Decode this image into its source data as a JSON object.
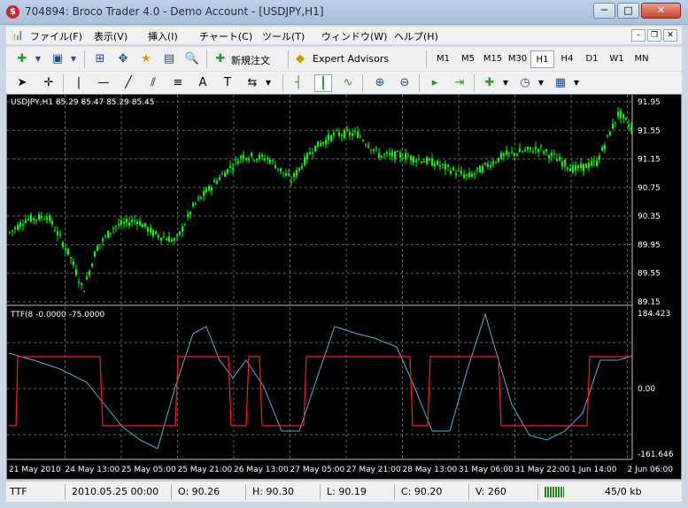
{
  "window": {
    "title": "704894: Broco Trader 4.0 - Demo Account - [USDJPY,H1]",
    "min_glyph": "─",
    "max_glyph": "□",
    "close_glyph": "✕"
  },
  "menu": {
    "items": [
      "ファイル(F)",
      "表示(V)",
      "挿入(I)",
      "チャート(C)",
      "ツール(T)",
      "ウィンドウ(W)",
      "ヘルプ(H)"
    ],
    "mdi": [
      "–",
      "❐",
      "✕"
    ]
  },
  "toolbar1": {
    "new_order_label": "新規注文",
    "expert_advisors_label": "Expert Advisors",
    "timeframes": [
      "M1",
      "M5",
      "M15",
      "M30",
      "H1",
      "H4",
      "D1",
      "W1",
      "MN"
    ],
    "active_timeframe": "H1"
  },
  "chart": {
    "symbol_label": "USDJPY,H1  85.29 85.47 85.29 85.45",
    "indicator_label": "TTF(8 -0.0000 -75.0000",
    "price_axis": [
      "91.95",
      "91.55",
      "91.15",
      "90.75",
      "90.35",
      "89.95",
      "89.55",
      "89.15"
    ],
    "indicator_axis": [
      "184.423",
      "0.00",
      "-161.646"
    ],
    "time_axis": [
      "21 May 2010",
      "24 May 13:00",
      "25 May 05:00",
      "25 May 21:00",
      "26 May 13:00",
      "27 May 05:00",
      "27 May 21:00",
      "28 May 13:00",
      "31 May 06:00",
      "31 May 22:00",
      "1 Jun 14:00",
      "2 Jun 06:00"
    ],
    "colors": {
      "candle": "#00ff00",
      "ttf_line": "#4fb3d9",
      "signal_line": "#ff1a1a",
      "grid": "#5a6a5a"
    }
  },
  "status": {
    "indicator": "TTF",
    "datetime": "2010.05.25 00:00",
    "open": "O: 90.26",
    "high": "H: 90.30",
    "low": "L: 90.19",
    "close": "C: 90.20",
    "volume": "V: 260",
    "traffic": "45/0 kb"
  }
}
